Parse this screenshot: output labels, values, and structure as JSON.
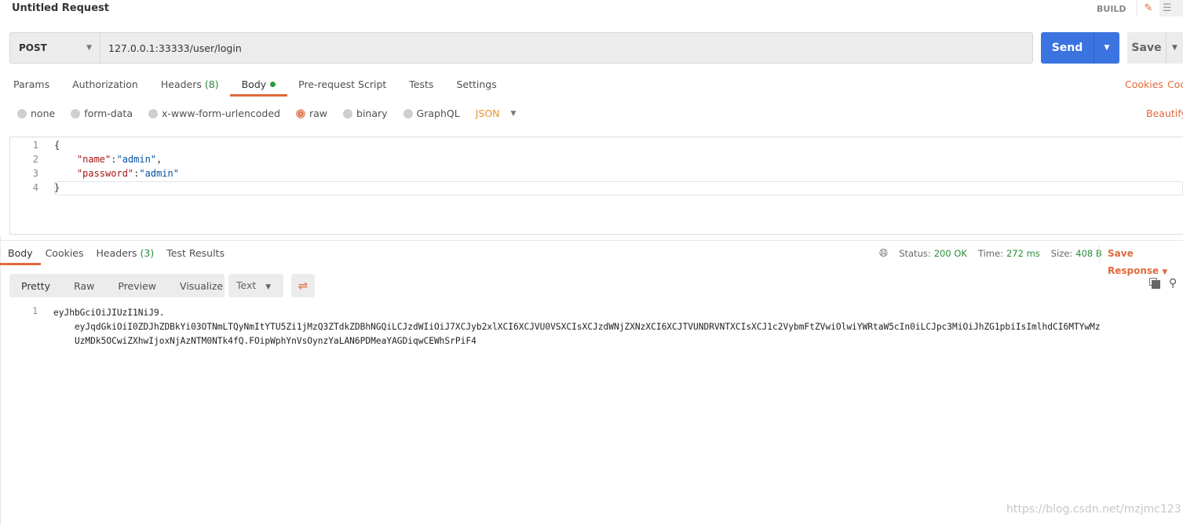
{
  "header": {
    "title": "Untitled Request",
    "mode": "BUILD"
  },
  "request": {
    "method": "POST",
    "url": "127.0.0.1:33333/user/login",
    "send_label": "Send",
    "save_label": "Save"
  },
  "tabs": [
    {
      "label": "Params"
    },
    {
      "label": "Authorization"
    },
    {
      "label": "Headers",
      "count": "(8)"
    },
    {
      "label": "Body"
    },
    {
      "label": "Pre-request Script"
    },
    {
      "label": "Tests"
    },
    {
      "label": "Settings"
    }
  ],
  "links": {
    "cookies": "Cookies",
    "code": "Coc",
    "beautify": "Beautify"
  },
  "body_types": [
    "none",
    "form-data",
    "x-www-form-urlencoded",
    "raw",
    "binary",
    "GraphQL"
  ],
  "body_type_selected": "raw",
  "format": "JSON",
  "editor": {
    "line_numbers": [
      "1",
      "2",
      "3",
      "4"
    ],
    "lines": [
      "{",
      "    \"name\":\"admin\",",
      "    \"password\":\"admin\"",
      "}"
    ],
    "key1": "\"name\"",
    "val1": "\"admin\"",
    "key2": "\"password\"",
    "val2": "\"admin\""
  },
  "response": {
    "tabs": [
      {
        "label": "Body"
      },
      {
        "label": "Cookies"
      },
      {
        "label": "Headers",
        "count": "(3)"
      },
      {
        "label": "Test Results"
      }
    ],
    "status_label": "Status:",
    "status": "200 OK",
    "time_label": "Time:",
    "time": "272 ms",
    "size_label": "Size:",
    "size": "408 B",
    "save_response": "Save Response",
    "view_tabs": [
      "Pretty",
      "Raw",
      "Preview",
      "Visualize"
    ],
    "format": "Text",
    "line_number": "1",
    "lines": [
      "eyJhbGciOiJIUzI1NiJ9.",
      "    eyJqdGkiOiI0ZDJhZDBkYi03OTNmLTQyNmItYTU5Zi1jMzQ3ZTdkZDBhNGQiLCJzdWIiOiJ7XCJyb2xlXCI6XCJVU0VSXCIsXCJzdWNjZXNzXCI6XCJTVUNDRVNTXCIsXCJ1c2VybmFtZVwiOlwiYWRtaW5cIn0iLCJpc3MiOiJhZG1pbiIsImlhdCI6MTYwMz",
      "    UzMDk5OCwiZXhwIjoxNjAzNTM0NTk4fQ.FOipWphYnVsOynzYaLAN6PDMeaYAGDiqwCEWhSrPiF4"
    ]
  },
  "watermark": "https://blog.csdn.net/mzjmc123",
  "colors": {
    "accent": "#e06a3c",
    "send": "#3b73e0",
    "success": "#2e8b3a"
  }
}
